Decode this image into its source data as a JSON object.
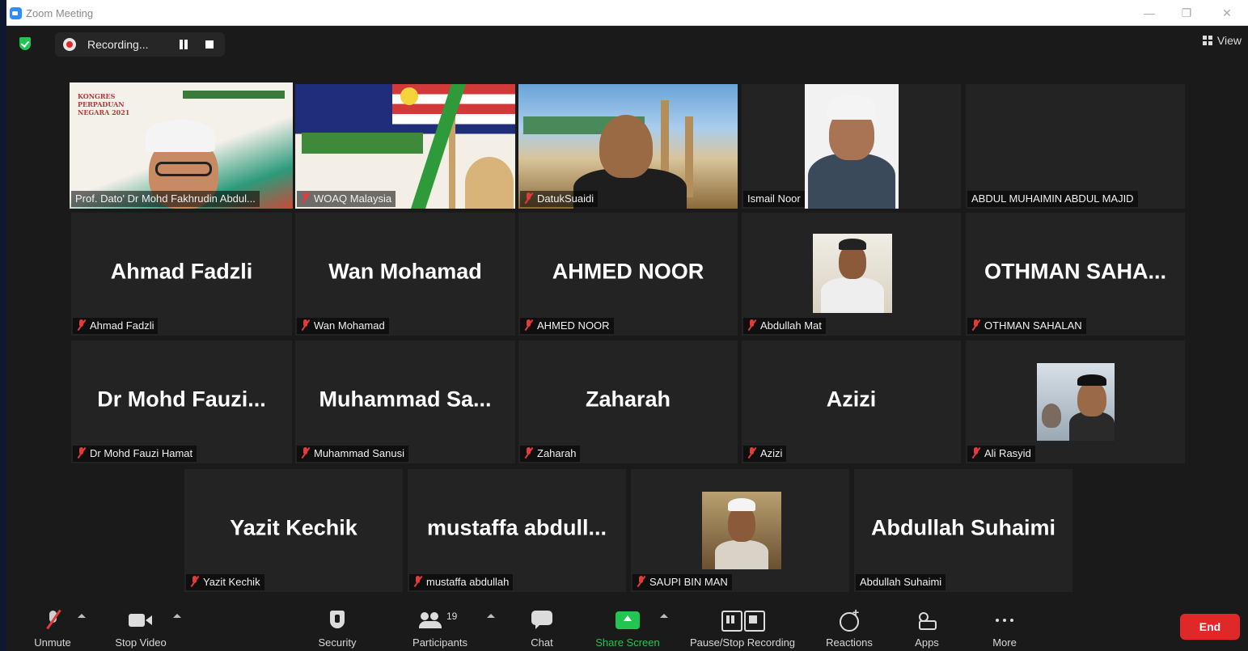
{
  "window": {
    "title": "Zoom Meeting"
  },
  "topbar": {
    "recording_label": "Recording...",
    "view_label": "View"
  },
  "tiles": [
    {
      "label": "Prof. Dato' Dr Mohd Fakhrudin Abdul...",
      "muted": false,
      "video": true,
      "active": true
    },
    {
      "label": "WOAQ Malaysia",
      "muted": true,
      "video": true
    },
    {
      "label": "DatukSuaidi",
      "muted": true,
      "video": true
    },
    {
      "label": "Ismail Noor",
      "muted": false,
      "video": true
    },
    {
      "label": "ABDUL MUHAIMIN ABDUL MAJID",
      "muted": false,
      "video": false,
      "big_name": ""
    },
    {
      "label": "Ahmad Fadzli",
      "muted": true,
      "video": false,
      "big_name": "Ahmad Fadzli"
    },
    {
      "label": "Wan Mohamad",
      "muted": true,
      "video": false,
      "big_name": "Wan Mohamad"
    },
    {
      "label": "AHMED NOOR",
      "muted": true,
      "video": false,
      "big_name": "AHMED NOOR"
    },
    {
      "label": "Abdullah Mat",
      "muted": true,
      "video": true
    },
    {
      "label": "OTHMAN SAHALAN",
      "muted": true,
      "video": false,
      "big_name": "OTHMAN  SAHA..."
    },
    {
      "label": "Dr Mohd Fauzi Hamat",
      "muted": true,
      "video": false,
      "big_name": "Dr Mohd Fauzi..."
    },
    {
      "label": "Muhammad Sanusi",
      "muted": true,
      "video": false,
      "big_name": "Muhammad  Sa..."
    },
    {
      "label": "Zaharah",
      "muted": true,
      "video": false,
      "big_name": "Zaharah"
    },
    {
      "label": "Azizi",
      "muted": true,
      "video": false,
      "big_name": "Azizi"
    },
    {
      "label": "Ali Rasyid",
      "muted": true,
      "video": true
    },
    {
      "label": "Yazit Kechik",
      "muted": true,
      "video": false,
      "big_name": "Yazit Kechik"
    },
    {
      "label": "mustaffa abdullah",
      "muted": true,
      "video": false,
      "big_name": "mustaffa  abdull..."
    },
    {
      "label": "SAUPI BIN MAN",
      "muted": true,
      "video": true
    },
    {
      "label": "Abdullah Suhaimi",
      "muted": false,
      "video": false,
      "big_name": "Abdullah Suhaimi"
    }
  ],
  "toolbar": {
    "unmute": "Unmute",
    "stop_video": "Stop Video",
    "security": "Security",
    "participants": "Participants",
    "participant_count": "19",
    "chat": "Chat",
    "share_screen": "Share Screen",
    "pause_stop_recording": "Pause/Stop Recording",
    "reactions": "Reactions",
    "apps": "Apps",
    "more": "More",
    "end": "End"
  },
  "colors": {
    "share_green": "#23c552",
    "end_red": "#e02828",
    "active_speaker": "#e8e46a",
    "mute_red": "#e33a3a"
  }
}
